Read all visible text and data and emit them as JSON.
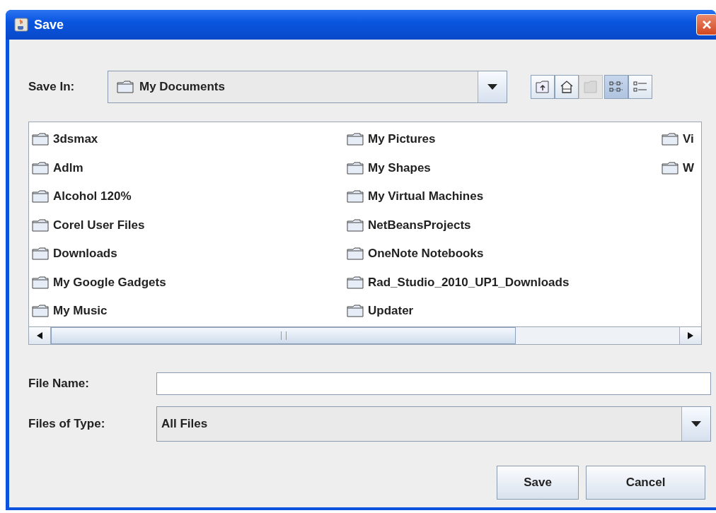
{
  "window": {
    "title": "Save"
  },
  "save_in": {
    "label": "Save In:",
    "value": "My Documents"
  },
  "toolbar": [
    {
      "kind": "up",
      "disabled": false,
      "selected": false
    },
    {
      "kind": "home",
      "disabled": false,
      "selected": false
    },
    {
      "kind": "new-folder",
      "disabled": true,
      "selected": false
    },
    {
      "kind": "list-view",
      "disabled": false,
      "selected": true
    },
    {
      "kind": "details-view",
      "disabled": false,
      "selected": false
    }
  ],
  "files": [
    {
      "name": "3dsmax"
    },
    {
      "name": "Adlm"
    },
    {
      "name": "Alcohol 120%"
    },
    {
      "name": "Corel User Files"
    },
    {
      "name": "Downloads"
    },
    {
      "name": "My Google Gadgets"
    },
    {
      "name": "My Music"
    },
    {
      "name": "My Pictures"
    },
    {
      "name": "My Shapes"
    },
    {
      "name": "My Virtual Machines"
    },
    {
      "name": "NetBeansProjects"
    },
    {
      "name": "OneNote Notebooks"
    },
    {
      "name": "Rad_Studio_2010_UP1_Downloads"
    },
    {
      "name": "Updater"
    },
    {
      "name": "Vi"
    },
    {
      "name": "W"
    }
  ],
  "file_name": {
    "label": "File Name:"
  },
  "file_type": {
    "label": "Files of Type:",
    "value": "All Files"
  },
  "buttons": [
    "Save",
    "Cancel"
  ]
}
